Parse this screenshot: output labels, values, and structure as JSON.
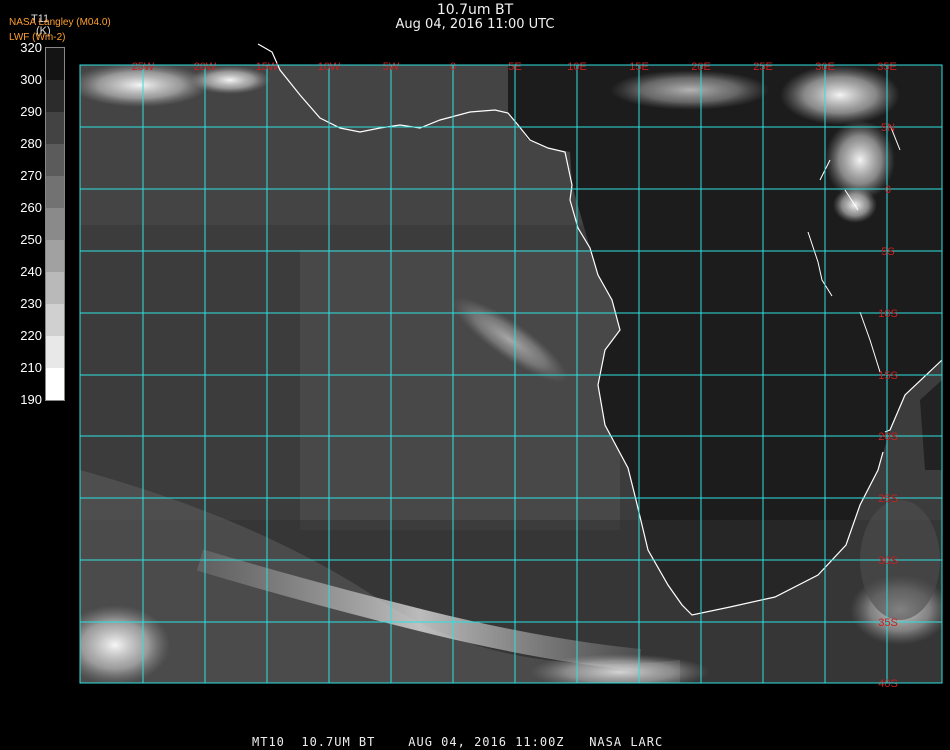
{
  "header": {
    "title": "10.7um BT",
    "datetime": "Aug 04, 2016 11:00 UTC"
  },
  "credits": {
    "line1": "NASA Langley (M04.0)",
    "line2": "LWF (Wm-2)"
  },
  "colorbar": {
    "title": "T11",
    "unit": "(K)",
    "ticks": [
      "320",
      "300",
      "290",
      "280",
      "270",
      "260",
      "250",
      "240",
      "230",
      "220",
      "210",
      "190"
    ]
  },
  "map": {
    "longitude_labels": [
      "25W",
      "20W",
      "15W",
      "10W",
      "5W",
      "0",
      "5E",
      "10E",
      "15E",
      "20E",
      "25E",
      "30E",
      "35E"
    ],
    "latitude_labels": [
      "5N",
      "0",
      "5S",
      "10S",
      "15S",
      "20S",
      "25S",
      "30S",
      "35S",
      "40S"
    ],
    "grid_color": "#2fe0e0",
    "label_color": "#cc1f1f"
  },
  "footer": {
    "text": "MT10  10.7UM BT    AUG 04, 2016 11:00Z   NASA LARC"
  }
}
